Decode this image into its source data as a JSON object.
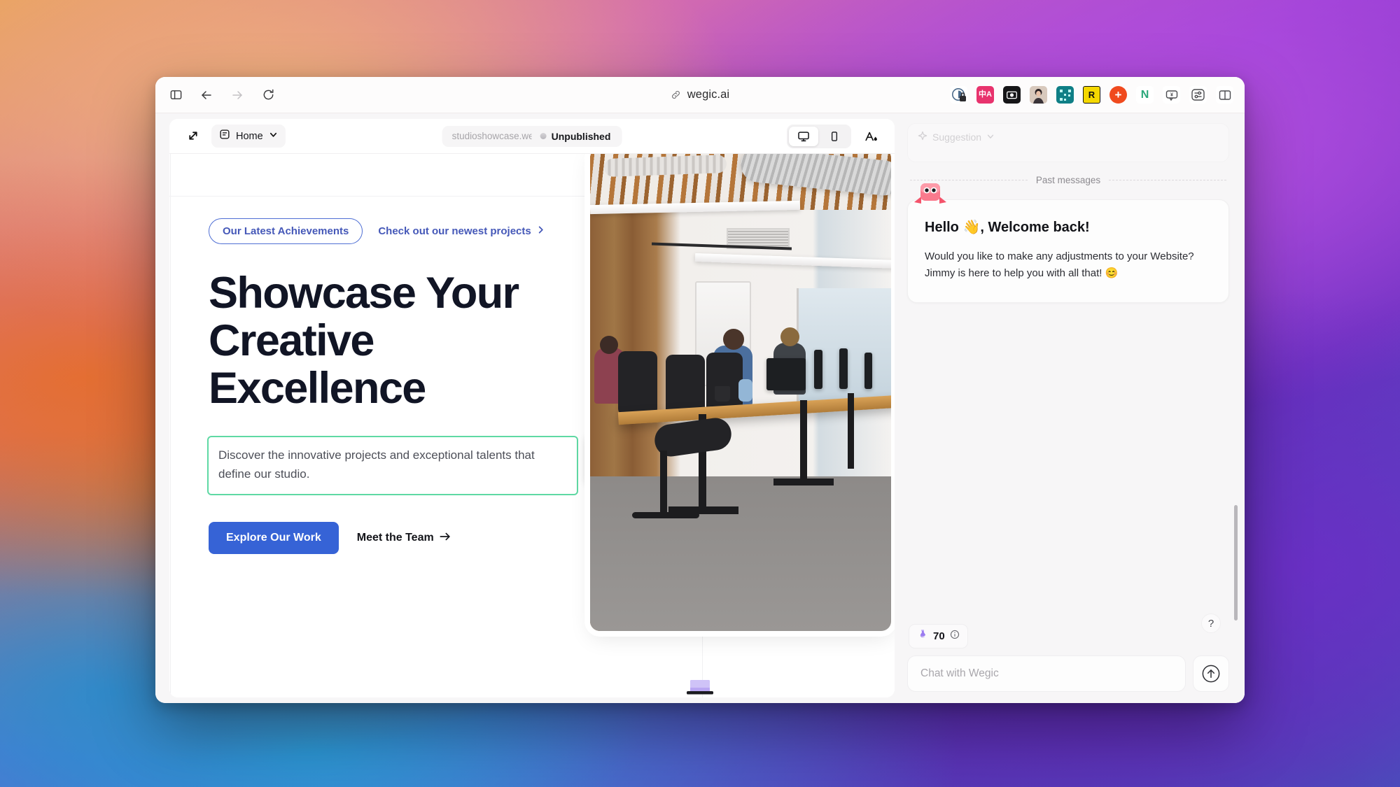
{
  "browser": {
    "nav": {
      "sidebar_toggle": "sidebar-toggle",
      "back": "back",
      "forward": "forward",
      "reload": "reload"
    },
    "url": "wegic.ai",
    "url_icon": "link-icon",
    "extensions": [
      {
        "name": "privacy-badger-icon",
        "label": ""
      },
      {
        "name": "translate-icon",
        "label": "中A"
      },
      {
        "name": "screenshot-icon",
        "label": ""
      },
      {
        "name": "avatar-extension-icon",
        "label": ""
      },
      {
        "name": "qr-code-icon",
        "label": ""
      },
      {
        "name": "readwise-icon",
        "label": "R"
      },
      {
        "name": "add-extension-icon",
        "label": "+"
      },
      {
        "name": "notion-icon",
        "label": "N"
      },
      {
        "name": "comment-extension-icon",
        "label": ""
      },
      {
        "name": "settings-extension-icon",
        "label": ""
      },
      {
        "name": "split-view-icon",
        "label": ""
      }
    ]
  },
  "editor": {
    "collapse_label": "collapse-panel",
    "page_selector": {
      "icon": "page-icon",
      "label": "Home",
      "chevron": "chevron-down-icon"
    },
    "site": {
      "domain": "studioshowcase.wegic",
      "publish_state": "Unpublished"
    },
    "devices": [
      {
        "name": "desktop",
        "icon": "monitor-icon",
        "active": true
      },
      {
        "name": "mobile",
        "icon": "phone-icon",
        "active": false
      }
    ],
    "text_tool": "text-style-icon"
  },
  "hero": {
    "badge": "Our Latest Achievements",
    "link": "Check out our newest projects",
    "link_icon": "chevron-right-icon",
    "title": "Showcase Your Creative Excellence",
    "description": "Discover the innovative projects and exceptional talents that define our studio.",
    "primary_cta": "Explore Our Work",
    "secondary_cta": "Meet the Team",
    "secondary_cta_icon": "arrow-right-icon",
    "selection_color": "#5fd9a4",
    "accent_color": "#3663d6",
    "tools": [
      {
        "name": "edit-text-icon"
      },
      {
        "name": "link-icon"
      }
    ],
    "image_alt": "open-plan office with people working at desks"
  },
  "chat": {
    "suggestion": {
      "icon": "sparkle-icon",
      "label": "Suggestion",
      "chevron": "chevron-down-icon"
    },
    "divider_label": "Past messages",
    "avatar": "robot-avatar",
    "message": {
      "greeting": "Hello 👋, Welcome back!",
      "body": "Would you like to make any adjustments to your Website? Jimmy is here to help you with all that! 😊"
    },
    "credits": {
      "icon": "potion-icon",
      "value": "70",
      "info_icon": "info-icon"
    },
    "input_placeholder": "Chat with Wegic",
    "input_value": "",
    "send_icon": "arrow-up-circle-icon",
    "help_label": "?"
  },
  "dock": {
    "app": "laptop-icon"
  }
}
